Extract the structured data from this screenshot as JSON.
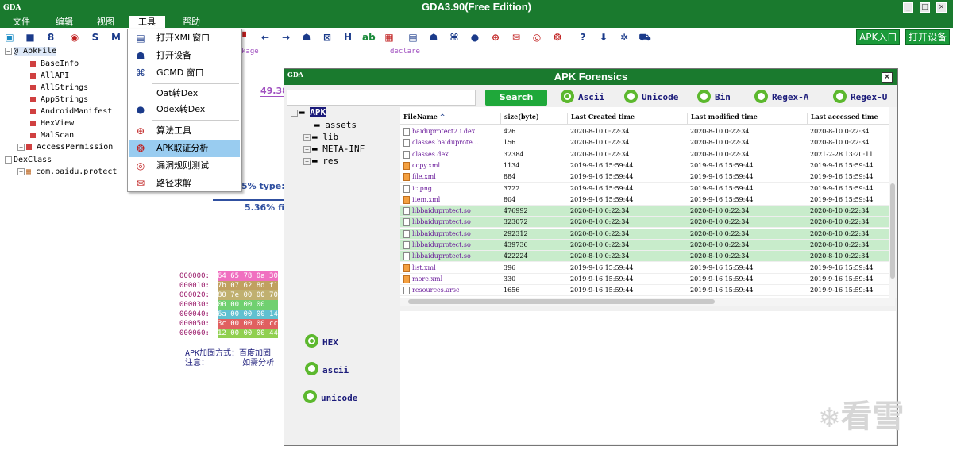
{
  "app": {
    "title": "GDA3.90(Free Edition)",
    "logo": "GDA",
    "window_buttons": [
      "_",
      "□",
      "×"
    ]
  },
  "menu": [
    "文件",
    "编辑",
    "视图",
    "工具",
    "帮助"
  ],
  "toolbar": {
    "buttons": {
      "apk_entry": "APK入口",
      "open_device": "打开设备"
    }
  },
  "left_tree": {
    "root": "@ ApkFile",
    "items": [
      "BaseInfo",
      "AllAPI",
      "AllStrings",
      "AppStrings",
      "AndroidManifest",
      "HexView",
      "MalScan",
      "AccessPermission"
    ],
    "dexclass": "DexClass",
    "pkg": "com.baidu.protect"
  },
  "bg_text": {
    "percent1": "49.38",
    "type": "5% type:1",
    "fields": "5.36% fie",
    "col1": "kage",
    "col2": "declare",
    "hex_addrs": [
      "000000:",
      "000010:",
      "000020:",
      "000030:",
      "000040:",
      "000050:",
      "000060:"
    ],
    "hex_bytes": [
      "64 65 78 0a 30",
      "7b 07 62 8d f1",
      "80 7e 00 00 70",
      "00 00 00 00",
      "6a 00 00 00 14",
      "3c 00 00 00 cc",
      "12 00 00 00 44"
    ],
    "apk_info1": "APK加固方式：百度加固",
    "apk_info2": "注意：       如需分析"
  },
  "context_menu": {
    "items": [
      "打开XML窗口",
      "打开设备",
      "GCMD 窗口",
      "Oat转Dex",
      "Odex转Dex",
      "算法工具",
      "APK取证分析",
      "漏洞规则测试",
      "路径求解"
    ],
    "highlighted": "APK取证分析"
  },
  "forensics": {
    "title": "APK Forensics",
    "search_label": "Search",
    "radios": [
      "Ascii",
      "Unicode",
      "Bin",
      "Regex-A",
      "Regex-U"
    ],
    "tree": {
      "root": "APK",
      "children": [
        "assets",
        "lib",
        "META-INF",
        "res"
      ]
    },
    "columns": [
      "FileName",
      "size(byte)",
      "Last Created time",
      "Last modified time",
      "Last accessed time"
    ],
    "rows": [
      [
        "baiduprotect2.i.dex",
        "426",
        "2020-8-10 0:22:34",
        "2020-8-10 0:22:34",
        "2020-8-10 0:22:34"
      ],
      [
        "classes.baiduprote...",
        "156",
        "2020-8-10 0:22:34",
        "2020-8-10 0:22:34",
        "2020-8-10 0:22:34"
      ],
      [
        "classes.dex",
        "32384",
        "2020-8-10 0:22:34",
        "2020-8-10 0:22:34",
        "2021-2-28 13:20:11"
      ],
      [
        "copy.xml",
        "1134",
        "2019-9-16 15:59:44",
        "2019-9-16 15:59:44",
        "2019-9-16 15:59:44"
      ],
      [
        "file.xml",
        "884",
        "2019-9-16 15:59:44",
        "2019-9-16 15:59:44",
        "2019-9-16 15:59:44"
      ],
      [
        "ic.png",
        "3722",
        "2019-9-16 15:59:44",
        "2019-9-16 15:59:44",
        "2019-9-16 15:59:44"
      ],
      [
        "item.xml",
        "804",
        "2019-9-16 15:59:44",
        "2019-9-16 15:59:44",
        "2019-9-16 15:59:44"
      ],
      [
        "libbaiduprotect.so",
        "476992",
        "2020-8-10 0:22:34",
        "2020-8-10 0:22:34",
        "2020-8-10 0:22:34"
      ],
      [
        "libbaiduprotect.so",
        "323072",
        "2020-8-10 0:22:34",
        "2020-8-10 0:22:34",
        "2020-8-10 0:22:34"
      ],
      [
        "libbaiduprotect.so",
        "292312",
        "2020-8-10 0:22:34",
        "2020-8-10 0:22:34",
        "2020-8-10 0:22:34"
      ],
      [
        "libbaiduprotect.so",
        "439736",
        "2020-8-10 0:22:34",
        "2020-8-10 0:22:34",
        "2020-8-10 0:22:34"
      ],
      [
        "libbaiduprotect.so",
        "422224",
        "2020-8-10 0:22:34",
        "2020-8-10 0:22:34",
        "2020-8-10 0:22:34"
      ],
      [
        "list.xml",
        "396",
        "2019-9-16 15:59:44",
        "2019-9-16 15:59:44",
        "2019-9-16 15:59:44"
      ],
      [
        "more.xml",
        "330",
        "2019-9-16 15:59:44",
        "2019-9-16 15:59:44",
        "2019-9-16 15:59:44"
      ],
      [
        "resources.arsc",
        "1656",
        "2019-9-16 15:59:44",
        "2019-9-16 15:59:44",
        "2019-9-16 15:59:44"
      ]
    ],
    "green_rows": [
      7,
      8,
      9,
      10,
      11
    ],
    "view_radios": [
      "HEX",
      "ascii",
      "unicode"
    ]
  },
  "watermark": "看雪"
}
